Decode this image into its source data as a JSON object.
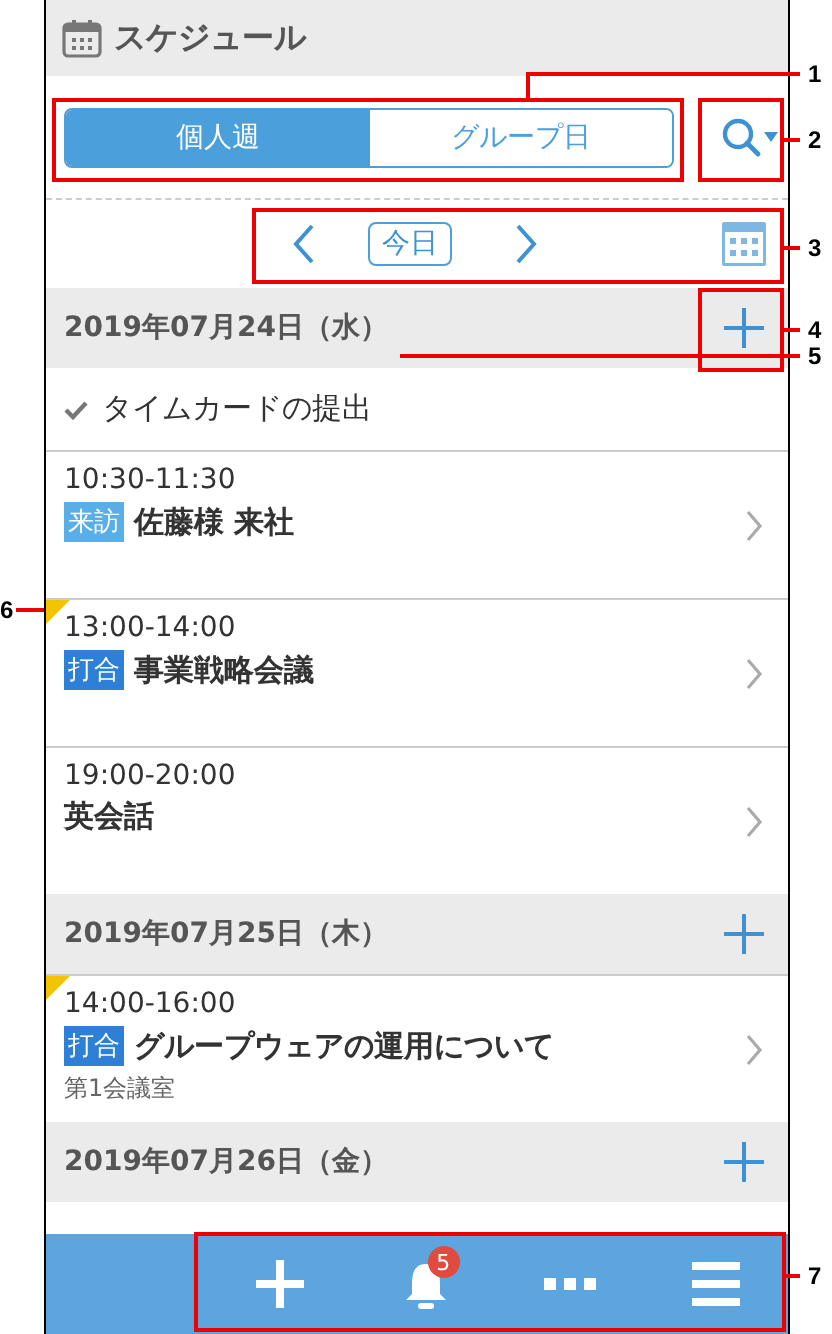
{
  "header": {
    "title": "スケジュール"
  },
  "view_tabs": [
    {
      "label": "個人週",
      "selected": true
    },
    {
      "label": "グループ日",
      "selected": false
    }
  ],
  "today_button": "今日",
  "days": [
    {
      "date": "2019年07月24日（水）",
      "tasks": [
        {
          "label": "タイムカードの提出",
          "done": true
        }
      ],
      "events": [
        {
          "time": "10:30-11:30",
          "tag": "来訪",
          "color": "#5aaee8",
          "title": "佐藤様 来社",
          "flagged": false
        },
        {
          "time": "13:00-14:00",
          "tag": "打合",
          "color": "#2e7fd6",
          "title": "事業戦略会議",
          "flagged": true
        },
        {
          "time": "19:00-20:00",
          "title": "英会話",
          "flagged": false
        }
      ]
    },
    {
      "date": "2019年07月25日（木）",
      "events": [
        {
          "time": "14:00-16:00",
          "tag": "打合",
          "color": "#2e7fd6",
          "title": "グループウェアの運用について",
          "location": "第1会議室",
          "flagged": true
        }
      ]
    },
    {
      "date": "2019年07月26日（金）"
    }
  ],
  "bottom_bar": {
    "notification_count": "5"
  },
  "callouts": [
    "1",
    "2",
    "3",
    "4",
    "5",
    "6",
    "7"
  ]
}
